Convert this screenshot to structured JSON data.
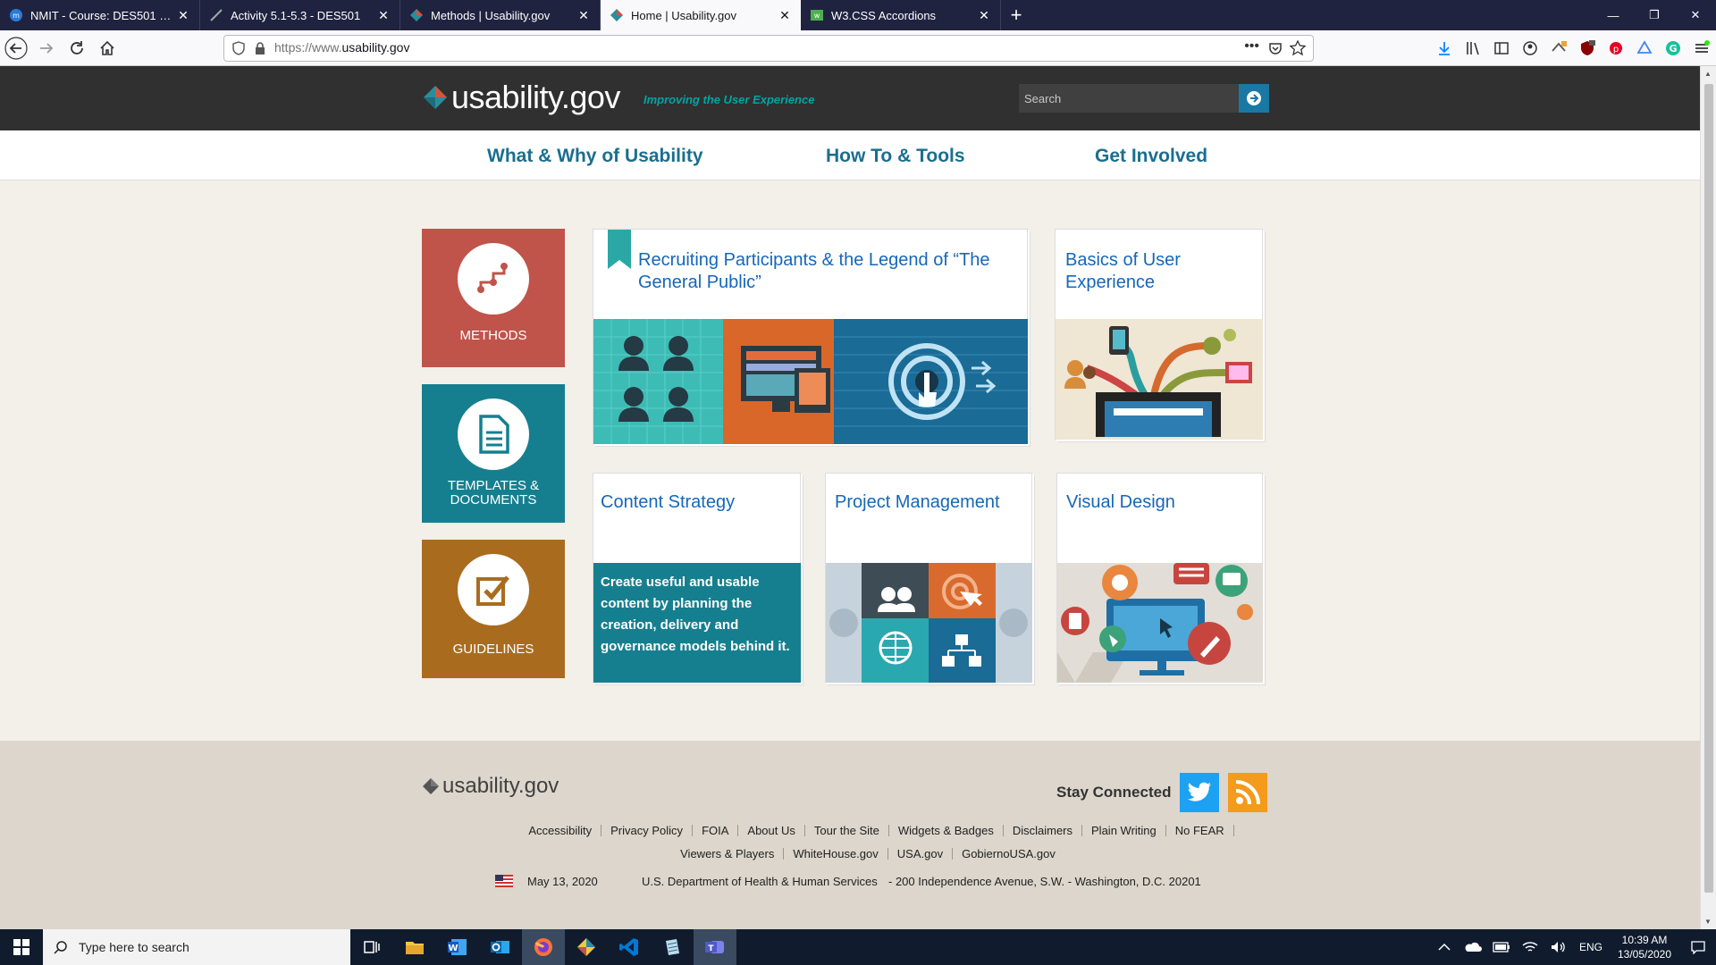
{
  "browser": {
    "tabs": [
      {
        "label": "NMIT - Course: DES501 Design",
        "active": false
      },
      {
        "label": "Activity 5.1-5.3 - DES501",
        "active": false
      },
      {
        "label": "Methods | Usability.gov",
        "active": false
      },
      {
        "label": "Home | Usability.gov",
        "active": true
      },
      {
        "label": "W3.CSS Accordions",
        "active": false
      }
    ],
    "url_prefix": "https://www.",
    "url_domain": "usability.gov"
  },
  "site": {
    "logo": "usability.gov",
    "tagline": "Improving the User Experience",
    "search_placeholder": "Search",
    "nav": [
      "What & Why of Usability",
      "How To & Tools",
      "Get Involved"
    ]
  },
  "sidebar": [
    {
      "label": "METHODS",
      "color": "#c0544a",
      "icon": "methods-icon"
    },
    {
      "label": "TEMPLATES & DOCUMENTS",
      "color": "#167f8f",
      "icon": "document-icon"
    },
    {
      "label": "GUIDELINES",
      "color": "#a96c1f",
      "icon": "checkbox-icon"
    }
  ],
  "cards": {
    "featured": "Recruiting Participants & the Legend of “The General Public”",
    "basics": "Basics of User Experience",
    "content": "Content Strategy",
    "content_desc": "Create useful and usable content by planning the creation, delivery and governance models behind it.",
    "project": "Project Management",
    "visual": "Visual Design"
  },
  "footer": {
    "logo": "usability.gov",
    "stay_connected": "Stay Connected",
    "links_row1": [
      "Accessibility",
      "Privacy Policy",
      "FOIA",
      "About Us",
      "Tour the Site",
      "Widgets & Badges",
      "Disclaimers",
      "Plain Writing",
      "No FEAR"
    ],
    "links_row2": [
      "Viewers & Players",
      "WhiteHouse.gov",
      "USA.gov",
      "GobiernoUSA.gov"
    ],
    "date": "May 13, 2020",
    "department": "U.S. Department of Health & Human Services",
    "address": "- 200 Independence Avenue, S.W. - Washington, D.C. 20201"
  },
  "taskbar": {
    "search_placeholder": "Type here to search",
    "language": "ENG",
    "time": "10:39 AM",
    "date": "13/05/2020"
  }
}
